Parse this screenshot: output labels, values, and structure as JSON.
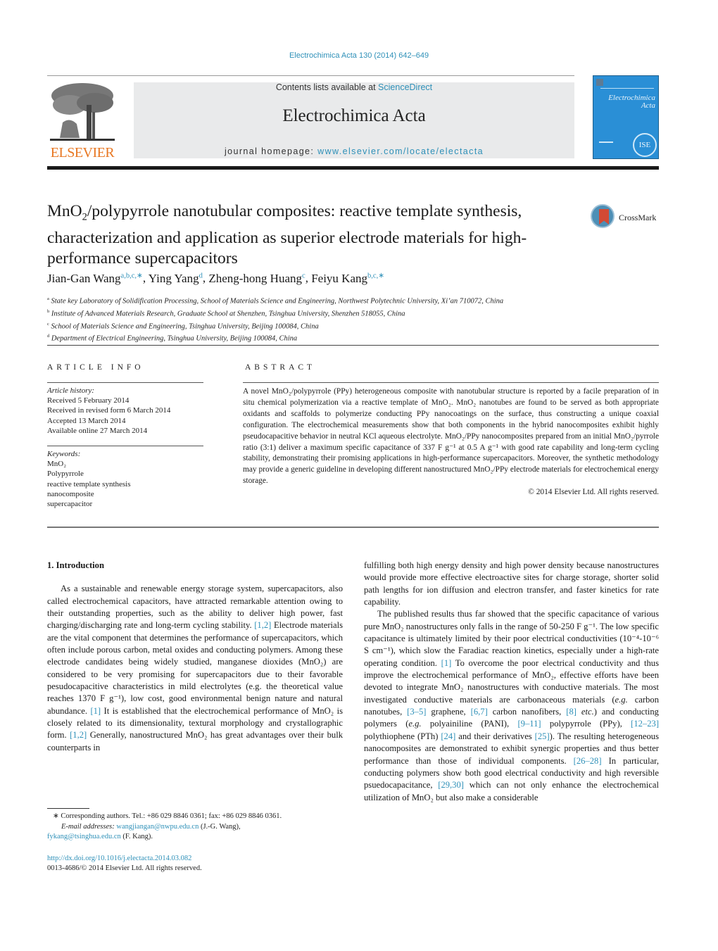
{
  "header": {
    "journal_ref": "Electrochimica Acta 130 (2014) 642–649",
    "contents_prefix": "Contents lists available at ",
    "contents_link": "ScienceDirect",
    "journal_name": "Electrochimica Acta",
    "homepage_prefix": "journal homepage: ",
    "homepage_link": "www.elsevier.com/locate/electacta",
    "publisher_logo_text": "ELSEVIER",
    "cover_title_line1": "Electrochimica",
    "cover_title_line2": "Acta",
    "cover_badge": "ISE"
  },
  "article": {
    "title_part1": "MnO",
    "title_sub": "2",
    "title_part2": "/polypyrrole nanotubular composites: reactive template synthesis, characterization and application as superior electrode materials for high-performance supercapacitors",
    "crossmark_label": "CrossMark",
    "authors": [
      {
        "name": "Jian-Gan Wang",
        "affil": "a,b,c,∗"
      },
      {
        "name": "Ying Yang",
        "affil": "d"
      },
      {
        "name": "Zheng-hong Huang",
        "affil": "c"
      },
      {
        "name": "Feiyu Kang",
        "affil": "b,c,∗"
      }
    ],
    "affiliations": [
      {
        "mark": "a",
        "text": "State key Laboratory of Solidification Processing, School of Materials Science and Engineering, Northwest Polytechnic University, Xi’an 710072, China"
      },
      {
        "mark": "b",
        "text": "Institute of Advanced Materials Research, Graduate School at Shenzhen, Tsinghua University, Shenzhen 518055, China"
      },
      {
        "mark": "c",
        "text": "School of Materials Science and Engineering, Tsinghua University, Beijing 100084, China"
      },
      {
        "mark": "d",
        "text": "Department of Electrical Engineering, Tsinghua University, Beijing 100084, China"
      }
    ]
  },
  "article_info": {
    "heading": "ARTICLE INFO",
    "history_label": "Article history:",
    "history": [
      "Received 5 February 2014",
      "Received in revised form 6 March 2014",
      "Accepted 13 March 2014",
      "Available online 27 March 2014"
    ],
    "keywords_label": "Keywords:",
    "keywords": [
      "MnO₂",
      "Polypyrrole",
      "reactive template synthesis",
      "nanocomposite",
      "supercapacitor"
    ]
  },
  "abstract": {
    "heading": "ABSTRACT",
    "text": "A novel MnO₂/polypyrrole (PPy) heterogeneous composite with nanotubular structure is reported by a facile preparation of in situ chemical polymerization via a reactive template of MnO₂. MnO₂ nanotubes are found to be served as both appropriate oxidants and scaffolds to polymerize conducting PPy nanocoatings on the surface, thus constructing a unique coaxial configuration. The electrochemical measurements show that both components in the hybrid nanocomposites exhibit highly pseudocapacitive behavior in neutral KCl aqueous electrolyte. MnO₂/PPy nanocomposites prepared from an initial MnO₂/pyrrole ratio (3:1) deliver a maximum specific capacitance of 337 F g⁻¹ at 0.5 A g⁻¹ with good rate capability and long-term cycling stability, demonstrating their promising applications in high-performance supercapacitors. Moreover, the synthetic methodology may provide a generic guideline in developing different nanostructured MnO₂/PPy electrode materials for electrochemical energy storage.",
    "copyright": "© 2014 Elsevier Ltd. All rights reserved."
  },
  "body": {
    "section_heading": "1.  Introduction",
    "left_paragraph": [
      {
        "t": "As a sustainable and renewable energy storage system, supercapacitors, also called electrochemical capacitors, have attracted remarkable attention owing to their outstanding properties, such as the ability to deliver high power, fast charging/discharging rate and long-term cycling stability. "
      },
      {
        "ref": "[1,2]"
      },
      {
        "t": " Electrode materials are the vital component that determines the performance of supercapacitors, which often include porous carbon, metal oxides and conducting polymers. Among these electrode candidates being widely studied, manganese dioxides (MnO₂) are considered to be very promising for supercapacitors due to their favorable pesudocapacitive characteristics in mild electrolytes (e.g. the theoretical value reaches 1370 F g⁻¹), low cost, good environmental benign nature and natural abundance. "
      },
      {
        "ref": "[1]"
      },
      {
        "t": " It is established that the electrochemical performance of MnO₂ is closely related to its dimensionality, textural morphology and crystallographic form. "
      },
      {
        "ref": "[1,2]"
      },
      {
        "t": " Generally, nanostructured MnO₂ has great advantages over their bulk counterparts in"
      }
    ],
    "right_paragraph_1": "fulfilling both high energy density and high power density because nanostructures would provide more effective electroactive sites for charge storage, shorter solid path lengths for ion diffusion and electron transfer, and faster kinetics for rate capability.",
    "right_paragraph_2": [
      {
        "t": "The published results thus far showed that the specific capacitance of various pure MnO₂ nanostructures only falls in the range of 50-250 F g⁻¹. The low specific capacitance is ultimately limited by their poor electrical conductivities (10⁻⁴-10⁻⁶ S cm⁻¹), which slow the Faradiac reaction kinetics, especially under a high-rate operating condition. "
      },
      {
        "ref": "[1]"
      },
      {
        "t": " To overcome the poor electrical conductivity and thus improve the electrochemical performance of MnO₂, effective efforts have been devoted to integrate MnO₂ nanostructures with conductive materials. The most investigated conductive materials are carbonaceous materials ("
      },
      {
        "i": "e.g."
      },
      {
        "t": " carbon nanotubes, "
      },
      {
        "ref": "[3–5]"
      },
      {
        "t": " graphene, "
      },
      {
        "ref": "[6,7]"
      },
      {
        "t": " carbon nanofibers, "
      },
      {
        "ref": "[8]"
      },
      {
        "t": " "
      },
      {
        "i": "etc."
      },
      {
        "t": ") and conducting polymers ("
      },
      {
        "i": "e.g."
      },
      {
        "t": " polyainiline (PANI), "
      },
      {
        "ref": "[9–11]"
      },
      {
        "t": " polypyrrole (PPy), "
      },
      {
        "ref": "[12–23]"
      },
      {
        "t": " polythiophene (PTh) "
      },
      {
        "ref": "[24]"
      },
      {
        "t": " and their derivatives "
      },
      {
        "ref": "[25]"
      },
      {
        "t": "). The resulting heterogeneous nanocomposites are demonstrated to exhibit synergic properties and thus better performance than those of individual components. "
      },
      {
        "ref": "[26–28]"
      },
      {
        "t": " In particular, conducting polymers show both good electrical conductivity and high reversible psuedocapacitance, "
      },
      {
        "ref": "[29,30]"
      },
      {
        "t": " which can not only enhance the electrochemical utilization of MnO₂ but also make a considerable"
      }
    ]
  },
  "footnotes": {
    "corresponding": "∗  Corresponding authors. Tel.: +86 029 8846 0361; fax: +86 029 8846 0361.",
    "email_label": "E-mail addresses: ",
    "email1": "wangjiangan@nwpu.edu.cn",
    "email1_owner": " (J.-G. Wang),",
    "email2": "fykang@tsinghua.edu.cn",
    "email2_owner": " (F. Kang).",
    "doi": "http://dx.doi.org/10.1016/j.electacta.2014.03.082",
    "issn_line": "0013-4686/© 2014 Elsevier Ltd. All rights reserved."
  },
  "colors": {
    "link": "#2e90b8",
    "elsevier_orange": "#e87722",
    "banner_bg": "#e9eaeb",
    "cover_blue": "#2a8fd6"
  }
}
